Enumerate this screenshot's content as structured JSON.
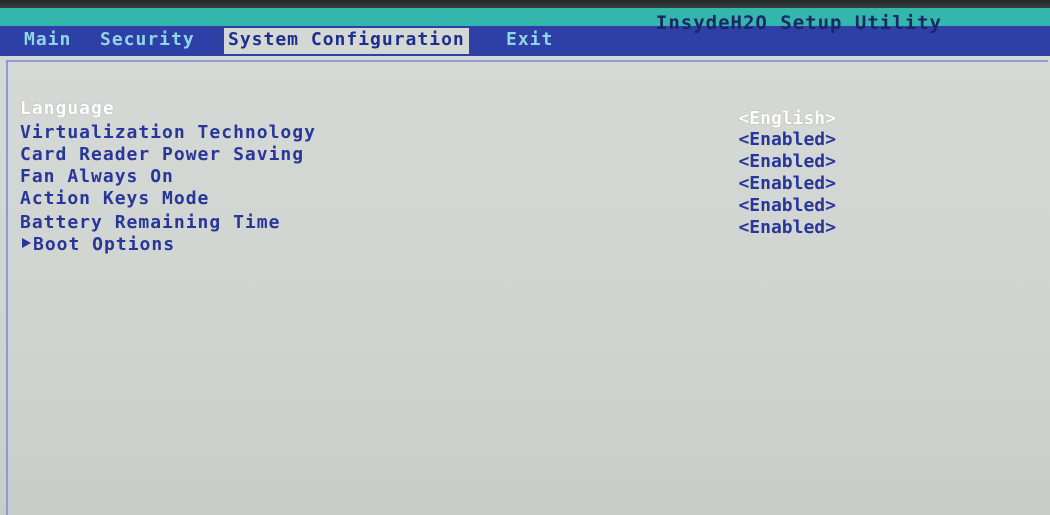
{
  "app": {
    "title": "InsydeH2O Setup Utility"
  },
  "menu": {
    "tabs": [
      {
        "label": "Main"
      },
      {
        "label": "Security"
      },
      {
        "label": "System Configuration",
        "active": true
      },
      {
        "label": "Exit"
      }
    ]
  },
  "settings": [
    {
      "label": "Language",
      "value": "<English>",
      "selected": true
    },
    {
      "label": "Virtualization Technology",
      "value": "<Enabled>"
    },
    {
      "label": "Card Reader Power Saving",
      "value": "<Enabled>"
    },
    {
      "label": "Fan Always On",
      "value": "<Enabled>"
    },
    {
      "label": "Action Keys Mode",
      "value": "<Enabled>"
    },
    {
      "label": "Battery Remaining Time",
      "value": "<Enabled>"
    }
  ],
  "submenu": {
    "label": "Boot Options",
    "icon": "triangle-right-icon"
  },
  "colors": {
    "title_band": "#33b6ab",
    "menu_bar": "#2e3fa6",
    "text": "#28369a",
    "selected_text": "#ffffff",
    "background": "#d0d5d1"
  }
}
